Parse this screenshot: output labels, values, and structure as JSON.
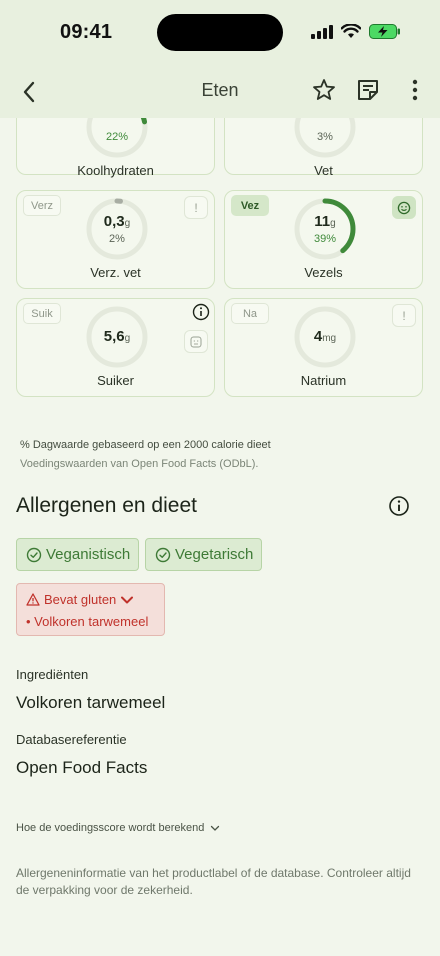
{
  "status": {
    "time": "09:41",
    "signal_icon": "signal-icon",
    "wifi_icon": "wifi-icon",
    "battery_icon": "battery-charging-icon"
  },
  "nav": {
    "title": "Eten",
    "back_icon": "chevron-left-icon",
    "star_icon": "star-icon",
    "notes_icon": "notes-icon",
    "more_icon": "more-vertical-icon"
  },
  "nutrients": [
    {
      "tag": "",
      "value": "",
      "unit": "",
      "percent": "22%",
      "label": "Koolhydraten",
      "fill": 0.22
    },
    {
      "tag": "",
      "value": "",
      "unit": "",
      "percent": "3%",
      "label": "Vet",
      "fill": 0.03
    },
    {
      "tag": "Verz",
      "value": "0,3",
      "unit": "g",
      "percent": "2%",
      "label": "Verz. vet",
      "fill": 0.02,
      "badge": "!"
    },
    {
      "tag": "Vez",
      "value": "11",
      "unit": "g",
      "percent": "39%",
      "label": "Vezels",
      "fill": 0.39,
      "badge_icon": "smiley-icon"
    },
    {
      "tag": "Suik",
      "value": "5,6",
      "unit": "g",
      "percent": "",
      "label": "Suiker",
      "fill": 0,
      "badge_icon": "square-face-icon"
    },
    {
      "tag": "Na",
      "value": "4",
      "unit": "mg",
      "percent": "",
      "label": "Natrium",
      "fill": 0,
      "badge": "!"
    }
  ],
  "notes": {
    "daily_value": "% Dagwaarde gebaseerd op een 2000 calorie dieet",
    "source": "Voedingswaarden van Open Food Facts (ODbL)."
  },
  "allergens": {
    "title": "Allergenen en dieet",
    "chips": [
      "Veganistisch",
      "Vegetarisch"
    ],
    "warning": {
      "title": "Bevat gluten",
      "items": [
        "• Volkoren tarwemeel"
      ]
    }
  },
  "ingredients": {
    "label": "Ingrediënten",
    "value": "Volkoren tarwemeel"
  },
  "database": {
    "label": "Databasereferentie",
    "value": "Open Food Facts"
  },
  "disclosure": "Hoe de voedingsscore wordt berekend",
  "disclaimer": "Allergeneninformatie van het productlabel of de database. Controleer altijd de verpakking voor de zekerheid.",
  "colors": {
    "accent_green": "#3f8a3a",
    "ring_track": "#e4e9dc",
    "warning_red": "#c0322b"
  }
}
